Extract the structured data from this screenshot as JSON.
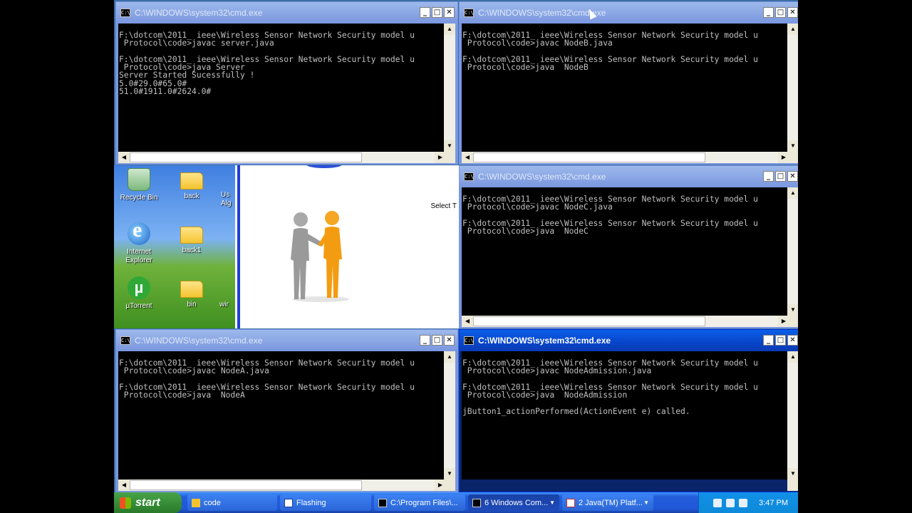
{
  "windows": [
    {
      "id": "server",
      "title": "C:\\WINDOWS\\system32\\cmd.exe",
      "active": false,
      "lines": [
        "F:\\dotcom\\2011_ ieee\\Wireless Sensor Network Security model u",
        " Protocol\\code>javac server.java",
        "",
        "F:\\dotcom\\2011_ ieee\\Wireless Sensor Network Security model u",
        " Protocol\\code>java Server",
        "Server Started Sucessfully !",
        "5.0#29.0#65.0#",
        "51.0#1911.0#2624.0#"
      ]
    },
    {
      "id": "nodeb",
      "title": "C:\\WINDOWS\\system32\\cmd.exe",
      "active": false,
      "lines": [
        "F:\\dotcom\\2011_ ieee\\Wireless Sensor Network Security model u",
        " Protocol\\code>javac NodeB.java",
        "",
        "F:\\dotcom\\2011_ ieee\\Wireless Sensor Network Security model u",
        " Protocol\\code>java  NodeB"
      ]
    },
    {
      "id": "nodec",
      "title": "C:\\WINDOWS\\system32\\cmd.exe",
      "active": false,
      "lines": [
        "F:\\dotcom\\2011_ ieee\\Wireless Sensor Network Security model u",
        " Protocol\\code>javac NodeC.java",
        "",
        "F:\\dotcom\\2011_ ieee\\Wireless Sensor Network Security model u",
        " Protocol\\code>java  NodeC"
      ]
    },
    {
      "id": "nodea",
      "title": "C:\\WINDOWS\\system32\\cmd.exe",
      "active": false,
      "lines": [
        "F:\\dotcom\\2011_ ieee\\Wireless Sensor Network Security model u",
        " Protocol\\code>javac NodeA.java",
        "",
        "F:\\dotcom\\2011_ ieee\\Wireless Sensor Network Security model u",
        " Protocol\\code>java  NodeA"
      ]
    },
    {
      "id": "nodeadmission",
      "title": "C:\\WINDOWS\\system32\\cmd.exe",
      "active": true,
      "lines": [
        "F:\\dotcom\\2011_ ieee\\Wireless Sensor Network Security model u",
        " Protocol\\code>javac NodeAdmission.java",
        "",
        "F:\\dotcom\\2011_ ieee\\Wireless Sensor Network Security model u",
        " Protocol\\code>java  NodeAdmission",
        "",
        "jButton1_actionPerformed(ActionEvent e) called."
      ]
    }
  ],
  "window_buttons": {
    "minimize": "_",
    "maximize": "□",
    "close": "✕"
  },
  "desktop": {
    "icons": [
      {
        "label": "Recycle Bin",
        "icon": "recycle-bin-icon"
      },
      {
        "label": "back",
        "icon": "folder-icon"
      },
      {
        "label": "Internet Explorer",
        "icon": "internet-explorer-icon"
      },
      {
        "label": "back1",
        "icon": "folder-icon"
      },
      {
        "label": "µTorrent",
        "icon": "utorrent-icon"
      },
      {
        "label": "bin",
        "icon": "folder-icon"
      }
    ],
    "partial_labels": [
      "Us",
      "Alg",
      "wir"
    ]
  },
  "presentation": {
    "select_text": "Select T"
  },
  "taskbar": {
    "start_label": "start",
    "tasks": [
      {
        "label": "code",
        "active": false
      },
      {
        "label": "Flashing",
        "active": false
      },
      {
        "label": "C:\\Program Files\\...",
        "active": false
      },
      {
        "label": "6 Windows Com...",
        "active": true
      },
      {
        "label": "2 Java(TM) Platf...",
        "active": false
      }
    ],
    "clock": "3:47 PM"
  },
  "colors": {
    "title_active": "#0845c9",
    "title_inactive": "#7a96df",
    "console_bg": "#000000",
    "console_text": "#c0c0c0",
    "taskbar": "#245edb",
    "start": "#388e38"
  }
}
